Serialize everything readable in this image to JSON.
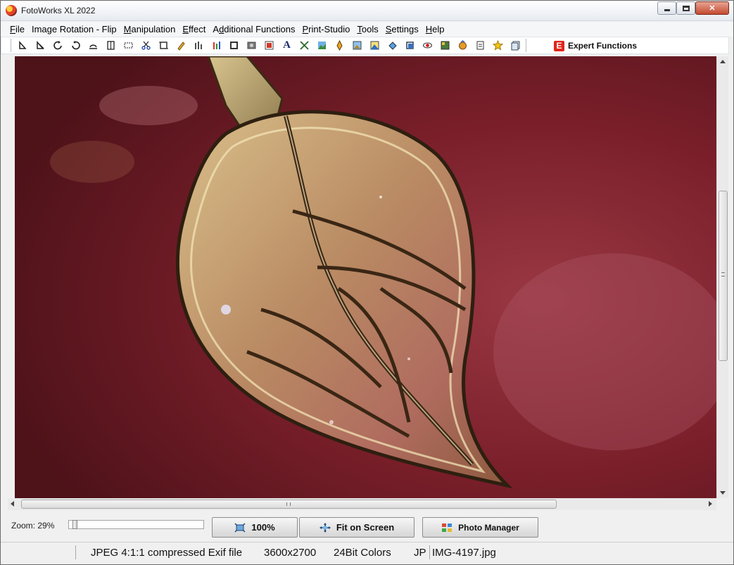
{
  "window": {
    "title": "FotoWorks XL 2022"
  },
  "menu": {
    "items": [
      {
        "label": "File",
        "u": "F",
        "rest": "ile"
      },
      {
        "label": "Image Rotation - Flip",
        "u": "",
        "rest": "Image Rotation - Flip"
      },
      {
        "label": "Manipulation",
        "u": "M",
        "rest": "anipulation"
      },
      {
        "label": "Effect",
        "u": "E",
        "rest": "ffect"
      },
      {
        "label": "Additional Functions",
        "pre": "A",
        "u": "d",
        "rest": "ditional Functions"
      },
      {
        "label": "Print-Studio",
        "u": "P",
        "rest": "rint-Studio"
      },
      {
        "label": "Tools",
        "u": "T",
        "rest": "ools"
      },
      {
        "label": "Settings",
        "u": "S",
        "rest": "ettings"
      },
      {
        "label": "Help",
        "u": "H",
        "rest": "elp"
      }
    ]
  },
  "toolbar": {
    "icons": [
      "rotate-left-icon",
      "rotate-right-icon",
      "rotate-ccw-icon",
      "rotate-cw-icon",
      "level-icon",
      "flip-icon",
      "crop-icon",
      "scissors-icon",
      "resize-icon",
      "pencil-icon",
      "histogram-icon",
      "color-balance-icon",
      "frame-icon",
      "photo-icon",
      "image-icon",
      "text-icon",
      "brush-icon",
      "landscape-icon",
      "pen-icon",
      "picture-icon",
      "mountain-icon",
      "fill-icon",
      "shadow-icon",
      "red-eye-icon",
      "collage-icon",
      "tag-icon",
      "stamp-icon",
      "star-icon",
      "documents-icon"
    ],
    "expert_icon_text": "E",
    "expert_label": "Expert Functions"
  },
  "bottom": {
    "zoom_label": "Zoom: 29%",
    "zoom_value": 0.29,
    "btn_100": "100%",
    "btn_fit": "Fit on Screen",
    "btn_photo_manager": "Photo Manager"
  },
  "status": {
    "format": "JPEG 4:1:1 compressed Exif file",
    "dimensions": "3600x2700",
    "colors": "24Bit Colors",
    "ext": "JP",
    "filename": "IMG-4197.jpg"
  },
  "colors": {
    "expert_red": "#e1251b",
    "background_red": "#7a1f29",
    "leaf_gold": "#c9a96a"
  }
}
